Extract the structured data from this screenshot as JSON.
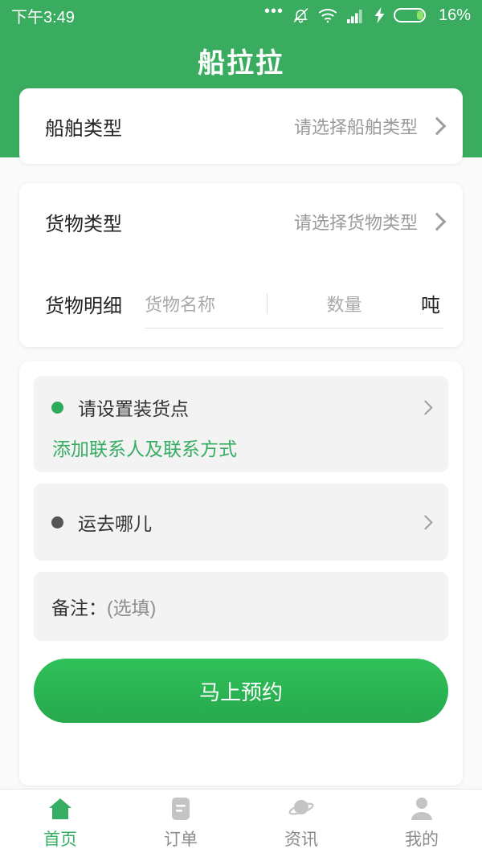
{
  "status_bar": {
    "time": "下午3:49",
    "battery_percent": "16%",
    "icons": [
      "more-dots-icon",
      "bell-muted-icon",
      "wifi-icon",
      "signal-bars-icon",
      "charging-bolt-icon",
      "battery-icon"
    ]
  },
  "header": {
    "title": "船拉拉",
    "background_color": "#3aac5f"
  },
  "theme": {
    "accent": "#35ad62",
    "button_gradient_top": "#2fc058",
    "button_gradient_bottom": "#27a94e",
    "page_background": "#fafafa",
    "block_background": "#f3f3f3"
  },
  "ship_type": {
    "label": "船舶类型",
    "placeholder": "请选择船舶类型",
    "chevron": "chevron-right-icon"
  },
  "cargo": {
    "type_label": "货物类型",
    "type_placeholder": "请选择货物类型",
    "detail_label": "货物明细",
    "name_placeholder": "货物名称",
    "qty_placeholder": "数量",
    "unit": "吨"
  },
  "route": {
    "load_point": {
      "dot": "green-dot-icon",
      "text": "请设置装货点",
      "contact_link": "添加联系人及联系方式",
      "chevron": "chevron-right-icon"
    },
    "destination": {
      "dot": "dark-dot-icon",
      "text": "运去哪儿",
      "chevron": "chevron-right-icon"
    },
    "note": {
      "label": "备注：",
      "hint": "(选填)"
    },
    "submit_label": "马上预约"
  },
  "tabbar": {
    "items": [
      {
        "label": "首页",
        "icon": "home-icon",
        "active": true
      },
      {
        "label": "订单",
        "icon": "order-document-icon",
        "active": false
      },
      {
        "label": "资讯",
        "icon": "planet-news-icon",
        "active": false
      },
      {
        "label": "我的",
        "icon": "person-icon",
        "active": false
      }
    ]
  }
}
